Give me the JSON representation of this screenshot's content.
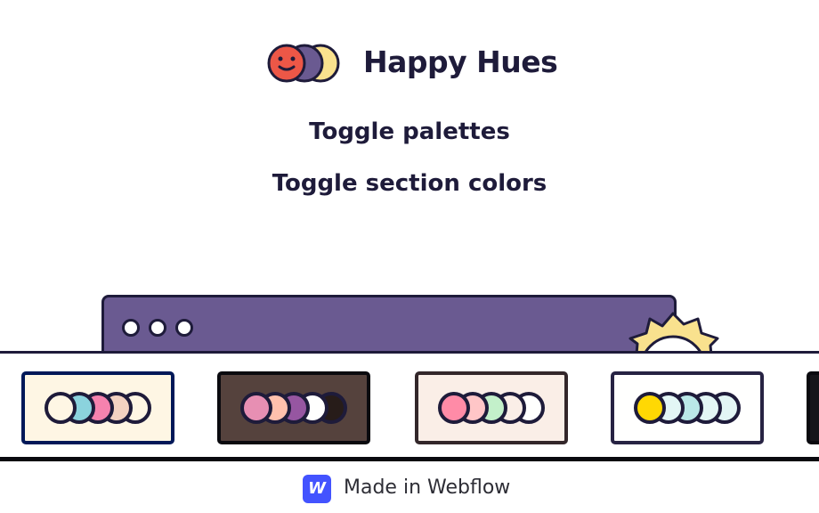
{
  "header": {
    "brand": "Happy Hues",
    "logo_icon": "smiling-overlapping-circles-logo"
  },
  "toggles": {
    "palettes": "Toggle palettes",
    "section_colors": "Toggle section colors"
  },
  "browser_mock": {
    "dot_icon": "window-dot",
    "sun_icon": "sun-icon"
  },
  "palettes": [
    {
      "background": "#fef6e4",
      "border": "#001858",
      "colors": [
        "#fef6e4",
        "#8bd3dd",
        "#f582ae",
        "#f3d2c1",
        "#fef6e4"
      ]
    },
    {
      "background": "#55423d",
      "border": "#0a0a0f",
      "colors": [
        "#e78fb3",
        "#ffc0ad",
        "#9656a1",
        "#fffffe",
        "#271c19"
      ]
    },
    {
      "background": "#faeee7",
      "border": "#33272a",
      "colors": [
        "#ff8ba7",
        "#ffc6c7",
        "#c3f0ca",
        "#faeee7",
        "#fffffe"
      ]
    },
    {
      "background": "#fffffe",
      "border": "#272343",
      "colors": [
        "#ffd803",
        "#e3f6f5",
        "#bae8e8",
        "#e3f6f5",
        "#e3f6f5"
      ]
    },
    {
      "background": "#16161a",
      "border": "#0a0a0f",
      "colors": []
    }
  ],
  "footer": {
    "badge": "W",
    "text": "Made in Webflow"
  }
}
